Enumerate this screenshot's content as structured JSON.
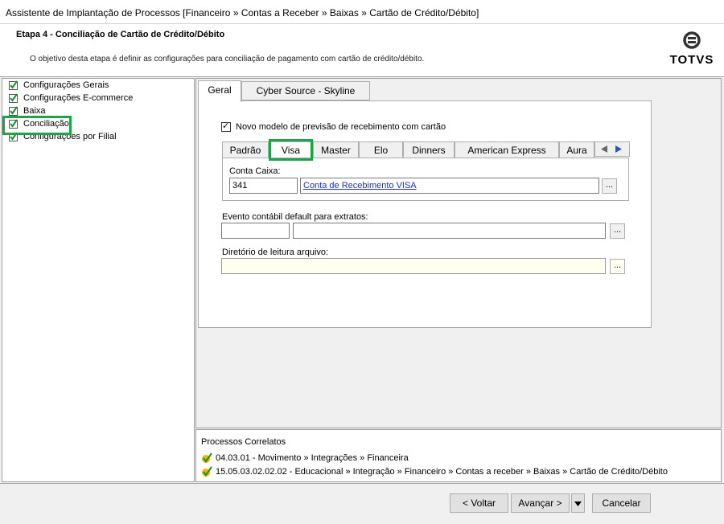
{
  "window": {
    "title": "Assistente de Implantação de Processos [Financeiro » Contas a Receber » Baixas » Cartão de Crédito/Débito]"
  },
  "header": {
    "step_title": "Etapa 4 - Conciliação de Cartão de Crédito/Débito",
    "description": "O objetivo desta etapa é definir as configurações para conciliação de pagamento com cartão de crédito/débito.",
    "logo_text": "TOTVS"
  },
  "tree": {
    "items": [
      {
        "label": "Configurações Gerais"
      },
      {
        "label": "Configurações E-commerce"
      },
      {
        "label": "Baixa"
      },
      {
        "label": "Conciliação"
      },
      {
        "label": "Configurações por Filial"
      }
    ]
  },
  "tabs": [
    {
      "label": "Geral"
    },
    {
      "label": "Cyber Source - Skyline"
    }
  ],
  "geral": {
    "checkbox_label": "Novo modelo de previsão de recebimento com cartão",
    "checkbox_checked": true,
    "card_tabs": [
      {
        "label": "Padrão"
      },
      {
        "label": "Visa"
      },
      {
        "label": "Master"
      },
      {
        "label": "Elo"
      },
      {
        "label": "Dinners"
      },
      {
        "label": "American Express"
      },
      {
        "label": "Aura"
      }
    ],
    "conta_caixa_label": "Conta Caixa:",
    "conta_caixa_code": "341",
    "conta_caixa_link": "Conta de Recebimento VISA",
    "evento_label": "Evento contábil default para extratos:",
    "evento_code": "",
    "evento_desc": "",
    "diretorio_label": "Diretório de leitura arquivo:",
    "diretorio_value": "",
    "browse_label": "..."
  },
  "related": {
    "title": "Processos Correlatos",
    "items": [
      {
        "label": "04.03.01 - Movimento » Integrações » Financeira"
      },
      {
        "label": "15.05.03.02.02.02 - Educacional » Integração » Financeiro » Contas a receber » Baixas » Cartão de Crédito/Débito"
      }
    ]
  },
  "footer": {
    "back": "< Voltar",
    "next": "Avançar >",
    "cancel": "Cancelar"
  },
  "colors": {
    "highlight": "#1fa34a",
    "link": "#1a33cc"
  }
}
